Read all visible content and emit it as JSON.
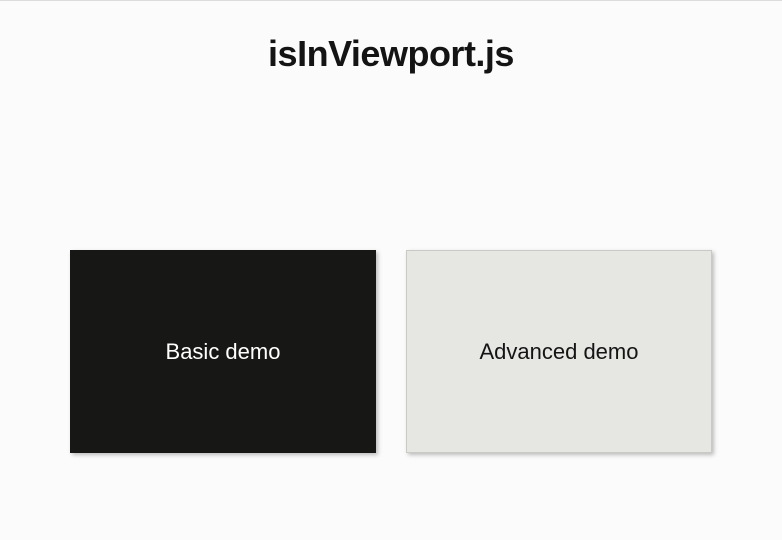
{
  "header": {
    "title": "isInViewport.js"
  },
  "cards": {
    "basic": {
      "label": "Basic demo"
    },
    "advanced": {
      "label": "Advanced demo"
    }
  },
  "colors": {
    "cardDark": "#171715",
    "cardLight": "#e6e6e3",
    "background": "#fbfbfb"
  }
}
